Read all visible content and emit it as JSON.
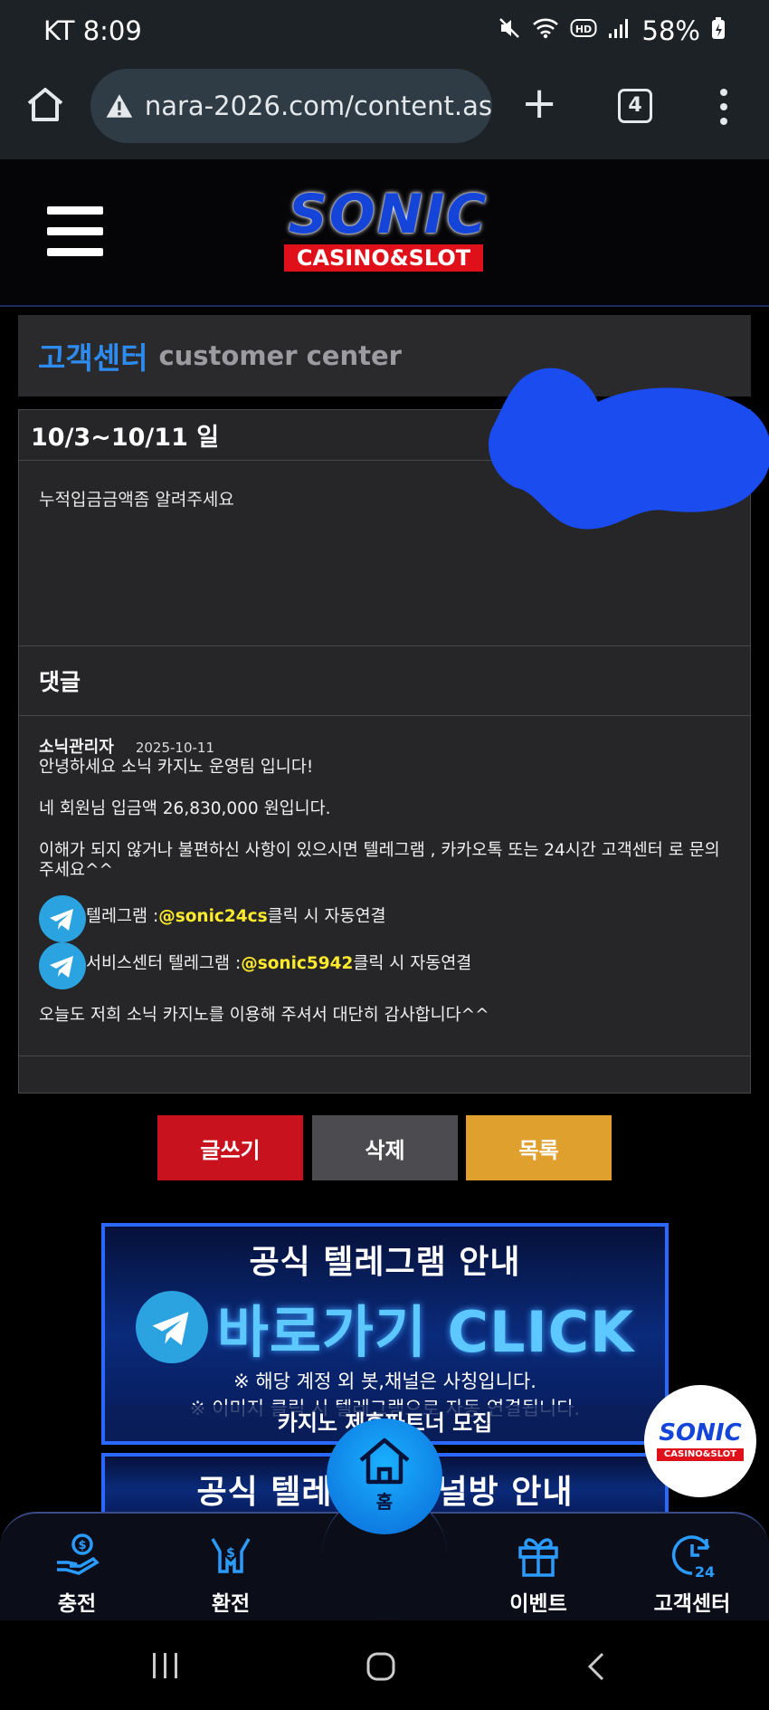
{
  "status_bar": {
    "carrier_time": "KT 8:09",
    "battery": "58%"
  },
  "browser": {
    "url": "nara-2026.com/content.as",
    "tab_count": "4"
  },
  "site": {
    "logo_main": "SONIC",
    "logo_sub": "CASINO&SLOT"
  },
  "page_header": {
    "title_ko": "고객센터",
    "title_en": "customer center"
  },
  "post": {
    "title": "10/3~10/11 일",
    "date_fragment": "11",
    "body": "누적입금금액좀 알려주세요"
  },
  "comments": {
    "label": "댓글",
    "items": [
      {
        "author": "소닉관리자",
        "date": "2025-10-11",
        "line1": "안녕하세요 소닉 카지노 운영팀 입니다!",
        "line2": "네 회원님 입금액 26,830,000 원입니다.",
        "line3": "이해가 되지 않거나 불편하신 사항이 있으시면 텔레그램 , 카카오톡 또는 24시간 고객센터 로 문의주세요^^",
        "tg1_prefix": "텔레그램 : ",
        "tg1_handle": "@sonic24cs",
        "tg1_suffix": " 클릭 시 자동연결",
        "tg2_prefix": "서비스센터 텔레그램 : ",
        "tg2_handle": "@sonic5942",
        "tg2_suffix": " 클릭 시 자동연결",
        "closing": "오늘도 저희 소닉 카지노를 이용해 주셔서 대단히 감사합니다^^"
      }
    ]
  },
  "actions": {
    "write": "글쓰기",
    "delete": "삭제",
    "list": "목록"
  },
  "banners": {
    "b1_title": "공식 텔레그램 안내",
    "b1_click": "바로가기 CLICK",
    "b1_note1": "※ 해당 계정 외 봇,채널은 사칭입니다.",
    "b1_note2": "※ 이미지 클릭 시 텔레그램으로 자동 연결됩니다.",
    "b1_partner": "카지노 제휴파트너 모집",
    "b2_title": "공식 텔레그램 채널방 안내"
  },
  "float_badge": {
    "main": "SONIC",
    "sub": "CASINO&SLOT"
  },
  "bottom_nav": [
    {
      "label": "충전",
      "icon": "deposit-icon"
    },
    {
      "label": "환전",
      "icon": "withdraw-icon"
    },
    {
      "label": "홈",
      "icon": "home-icon"
    },
    {
      "label": "이벤트",
      "icon": "gift-icon"
    },
    {
      "label": "고객센터",
      "icon": "support-24-icon"
    }
  ],
  "colors": {
    "accent_blue": "#2e8cf0",
    "highlight_yellow": "#ffea2e",
    "write_red": "#c8121e",
    "delete_gray": "#4c4b4f",
    "list_orange": "#e0a02e"
  }
}
